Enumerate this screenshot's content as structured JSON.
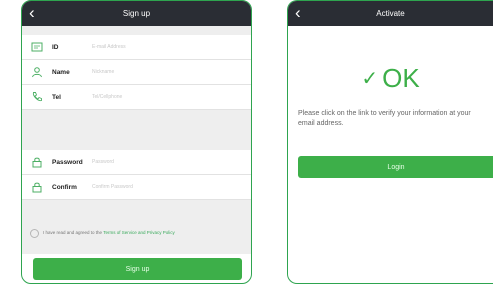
{
  "signup": {
    "title": "Sign up",
    "fields_group1": [
      {
        "label": "ID",
        "placeholder": "E-mail Address",
        "icon": "id-card-icon"
      },
      {
        "label": "Name",
        "placeholder": "Nickname",
        "icon": "person-icon"
      },
      {
        "label": "Tel",
        "placeholder": "Tel/Cellphone",
        "icon": "phone-icon"
      }
    ],
    "fields_group2": [
      {
        "label": "Password",
        "placeholder": "Password",
        "icon": "lock-icon"
      },
      {
        "label": "Confirm",
        "placeholder": "Confirm Password",
        "icon": "lock-icon"
      }
    ],
    "agree_text": "I have read and agreed to the",
    "agree_link": "Terms of Service and Privacy Policy",
    "button": "Sign up"
  },
  "activate": {
    "title": "Activate",
    "ok_text": "OK",
    "message": "Please click on the link to verify your information at your email address.",
    "button": "Login"
  },
  "colors": {
    "accent": "#3daf49",
    "titlebar": "#2a2d34",
    "icon": "#4caf64"
  }
}
